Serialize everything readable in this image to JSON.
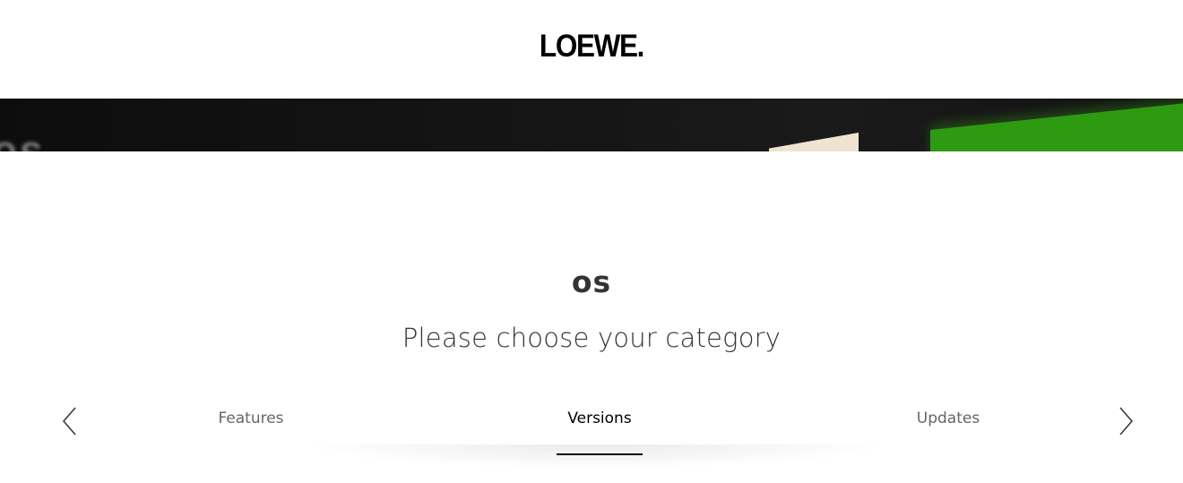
{
  "header": {
    "logo_text": "LOEWE."
  },
  "hero": {
    "text": "os",
    "colors": {
      "background": "#121212",
      "card": "#efe4d0",
      "green": "#2d9a12"
    }
  },
  "main": {
    "title": "os",
    "subtitle": "Please choose your category"
  },
  "tabs": [
    {
      "label": "Features",
      "active": false
    },
    {
      "label": "Versions",
      "active": true
    },
    {
      "label": "Updates",
      "active": false
    }
  ],
  "navigation": {
    "prev_icon": "chevron-left-icon",
    "next_icon": "chevron-right-icon"
  },
  "colors": {
    "text_primary": "#333333",
    "tab_inactive": "#666666",
    "tab_active": "#000000"
  }
}
